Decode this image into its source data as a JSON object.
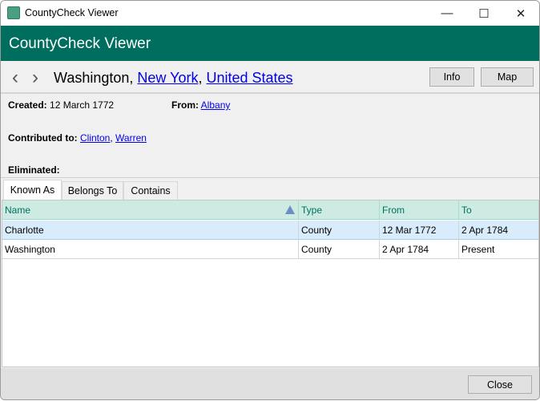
{
  "window": {
    "title": "CountyCheck Viewer",
    "minimize_icon": "minimize-icon",
    "maximize_icon": "maximize-icon",
    "close_icon": "close-icon"
  },
  "header": {
    "title": "CountyCheck Viewer",
    "color": "#006e5e"
  },
  "nav": {
    "back": "‹",
    "forward": "›",
    "place": "Washington",
    "sep1": ", ",
    "state": "New York",
    "sep2": ", ",
    "country": "United States",
    "info_label": "Info",
    "map_label": "Map"
  },
  "details": {
    "created_label": "Created:",
    "created_value": "12 March 1772",
    "from_label": "From:",
    "from_link": "Albany",
    "contributed_label": "Contributed to:",
    "contributed_links": [
      "Clinton",
      "Warren"
    ],
    "contributed_sep": ", ",
    "eliminated_label": "Eliminated:"
  },
  "tabs": [
    {
      "label": "Known As",
      "active": true
    },
    {
      "label": "Belongs To"
    },
    {
      "label": "Contains"
    }
  ],
  "grid": {
    "columns": [
      "Name",
      "Type",
      "From",
      "To"
    ],
    "sort": {
      "column": "Name",
      "direction": "ascending"
    },
    "rows": [
      [
        "Charlotte",
        "County",
        "12 Mar 1772",
        "2 Apr 1784"
      ],
      [
        "Washington",
        "County",
        "2 Apr 1784",
        "Present"
      ]
    ],
    "selected_row": 0
  },
  "footer": {
    "close_label": "Close"
  }
}
